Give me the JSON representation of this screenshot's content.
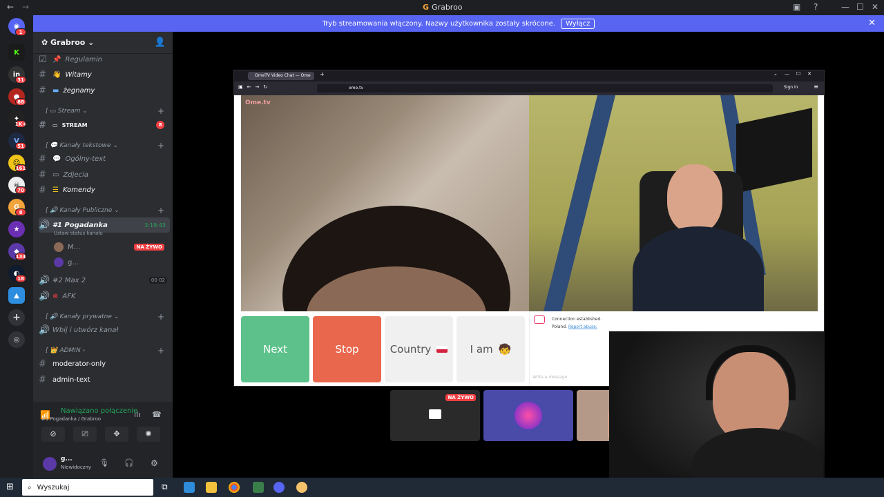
{
  "app": {
    "title": "Grabroo"
  },
  "banner": {
    "text": "Tryb streamowania włączony. Nazwy użytkownika zostały skrócone.",
    "button": "Wyłącz"
  },
  "rail": {
    "badges": [
      "1",
      "31",
      "88",
      "1K+",
      "51",
      "161",
      "70",
      "8",
      "134",
      "18"
    ]
  },
  "guild": {
    "name": "Grabroo"
  },
  "channels": {
    "regulamin": "Regulamin",
    "witamy": "Witamy",
    "zegnamy": "żegnamy",
    "cat_stream": "Stream",
    "stream": "STREAM",
    "stream_badge": "8",
    "cat_text": "Kanały tekstowe",
    "ogolny": "Ogólny-text",
    "zdjecia": "Zdjecia",
    "komendy": "Komendy",
    "cat_public": "Kanały Publiczne",
    "pogadanka": "#1 Pogadanka",
    "pogadanka_time": "3:19:43",
    "status": "Ustaw status kanału",
    "user1": "M...",
    "live_badge": "NA ŻYWO",
    "user2": "g...",
    "max2": "#2 Max 2",
    "max2_count_a": "00",
    "max2_count_b": "02",
    "afk": "AFK",
    "cat_private": "Kanały prywatne",
    "wbij": "Wbij i utwórz kanał",
    "cat_admin": "ADMIN",
    "moderator": "moderator-only",
    "admintext": "admin-text"
  },
  "voice": {
    "status": "Nawiązano połączenie",
    "channel": "#1 Pogadanka / Grabroo",
    "username": "g...",
    "presence": "Niewidoczny"
  },
  "browser": {
    "tab": "OmeTV Video Chat — Ome",
    "url": "ome.tv",
    "sign_in": "Sign in",
    "logo": "Ome.tv",
    "next": "Next",
    "stop": "Stop",
    "country": "Country",
    "iam": "I am",
    "chat_msg1": "Connection established.",
    "chat_country": "Poland.",
    "chat_report": "Report abuse.",
    "chat_placeholder": "Write a message"
  },
  "thumbs": {
    "live": "NA ŻYWO"
  },
  "taskbar": {
    "search": "Wyszukaj"
  }
}
